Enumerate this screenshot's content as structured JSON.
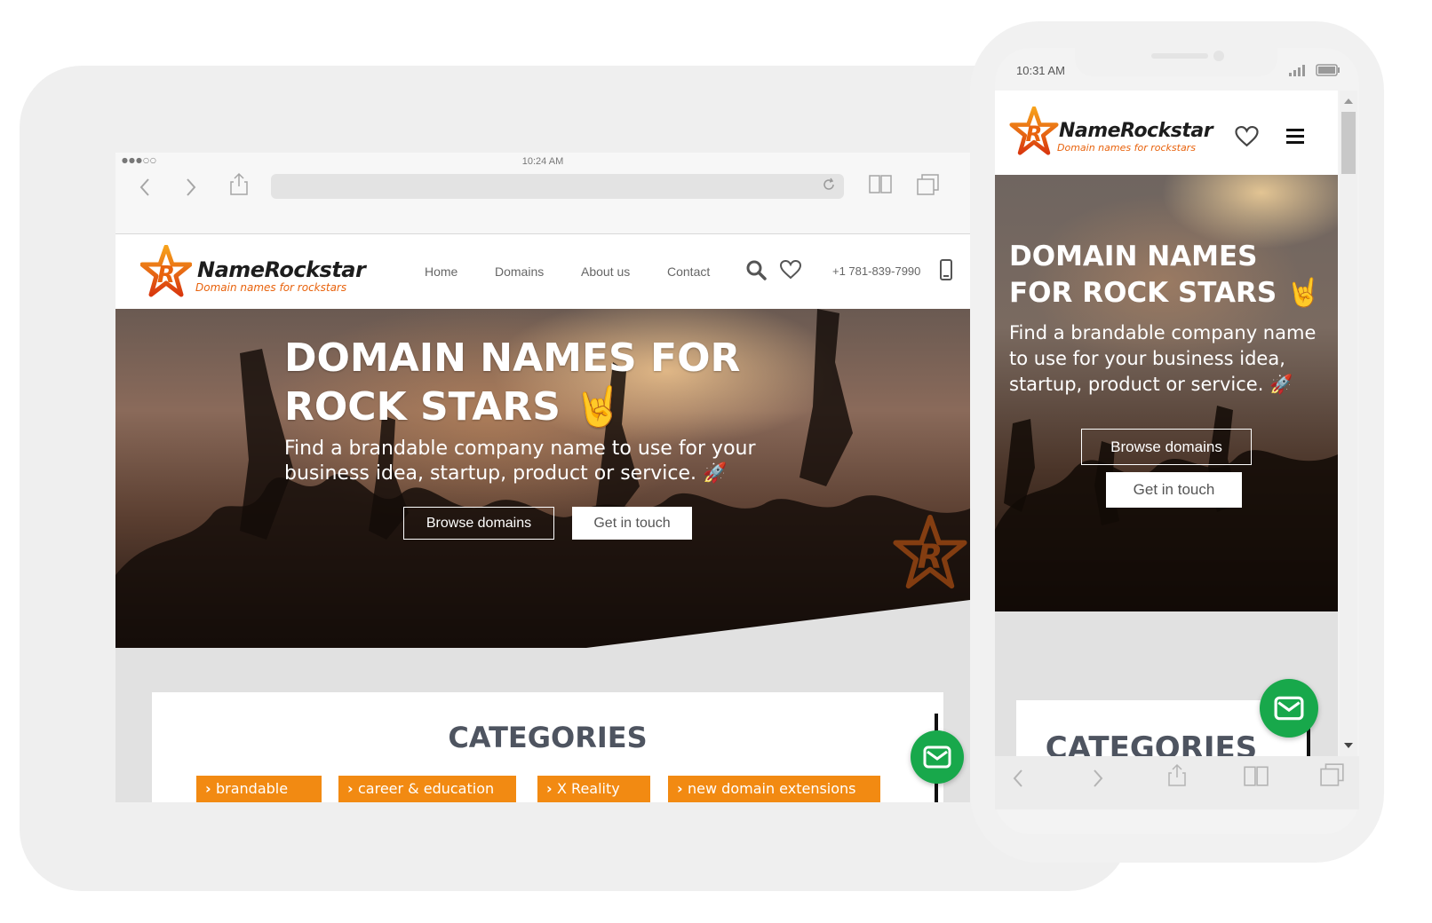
{
  "tablet": {
    "status_time": "10:24 AM",
    "status_signal": "●●●○○",
    "browser": {
      "back_icon": "chevron-left-icon",
      "forward_icon": "chevron-right-icon",
      "share_icon": "share-icon",
      "reload_icon": "reload-icon",
      "bookmarks_icon": "book-icon",
      "tabs_icon": "tabs-icon"
    },
    "site": {
      "logo_name": "NameRockstar",
      "logo_tagline": "Domain names for rockstars",
      "nav": [
        "Home",
        "Domains",
        "About us",
        "Contact"
      ],
      "phone": "+1 781-839-7990",
      "hero_title": "DOMAIN NAMES FOR ROCK STARS 🤘",
      "hero_subtitle": "Find a brandable company name to use for your business idea, startup, product or service. 🚀",
      "browse_button": "Browse domains",
      "contact_button": "Get in touch",
      "categories_title": "CATEGORIES",
      "categories": [
        "brandable",
        "career & education",
        "X Reality",
        "new domain extensions"
      ]
    }
  },
  "phone": {
    "status_time": "10:31 AM",
    "site": {
      "logo_name": "NameRockstar",
      "logo_tagline": "Domain names for rockstars",
      "hero_title": "DOMAIN NAMES FOR ROCK STARS 🤘",
      "hero_subtitle": "Find a brandable company name to use for your business idea, startup, product or service. 🚀",
      "browse_button": "Browse domains",
      "contact_button": "Get in touch",
      "categories_title": "CATEGORIES"
    }
  },
  "colors": {
    "brand_orange": "#f28a12",
    "tagline_orange": "#e8620c",
    "mail_green": "#18a84b",
    "heading_gray": "#4e5460"
  }
}
